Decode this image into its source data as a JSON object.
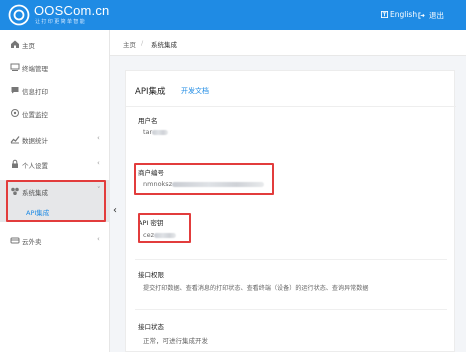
{
  "header": {
    "brand": "OOSCom.cn",
    "tagline": "让打印更简单智能",
    "language": "English",
    "logout": "退出"
  },
  "sidebar": {
    "items": [
      {
        "label": "主页",
        "icon": "home-icon"
      },
      {
        "label": "终端管理",
        "icon": "terminal-icon"
      },
      {
        "label": "信息打印",
        "icon": "message-icon"
      },
      {
        "label": "位置监控",
        "icon": "location-icon"
      },
      {
        "label": "数据统计",
        "icon": "chart-icon"
      },
      {
        "label": "个人设置",
        "icon": "lock-icon"
      },
      {
        "label": "系统集成",
        "icon": "integration-icon"
      },
      {
        "label": "云外卖",
        "icon": "delivery-icon"
      }
    ],
    "sub_active": "API集成"
  },
  "breadcrumb": {
    "home": "主页",
    "separator": "/",
    "current": "系统集成"
  },
  "card": {
    "title": "API集成",
    "doc_link": "开发文档",
    "fields": {
      "username_label": "用户名",
      "username_value": "tar",
      "account_label": "商户编号",
      "account_value": "nmnoksz",
      "key_label": "API 密钥",
      "key_value": "cez",
      "perm_label": "接口权限",
      "perm_value": "提交打印数据、查看消息的打印状态、查看终端（设备）的运行状态、查询异常数据",
      "status_label": "接口状态",
      "status_value": "正常，可进行集成开发"
    }
  },
  "colors": {
    "primary": "#1f8be4",
    "highlight": "#e23c3c",
    "active_bg": "#e6e7e9"
  }
}
